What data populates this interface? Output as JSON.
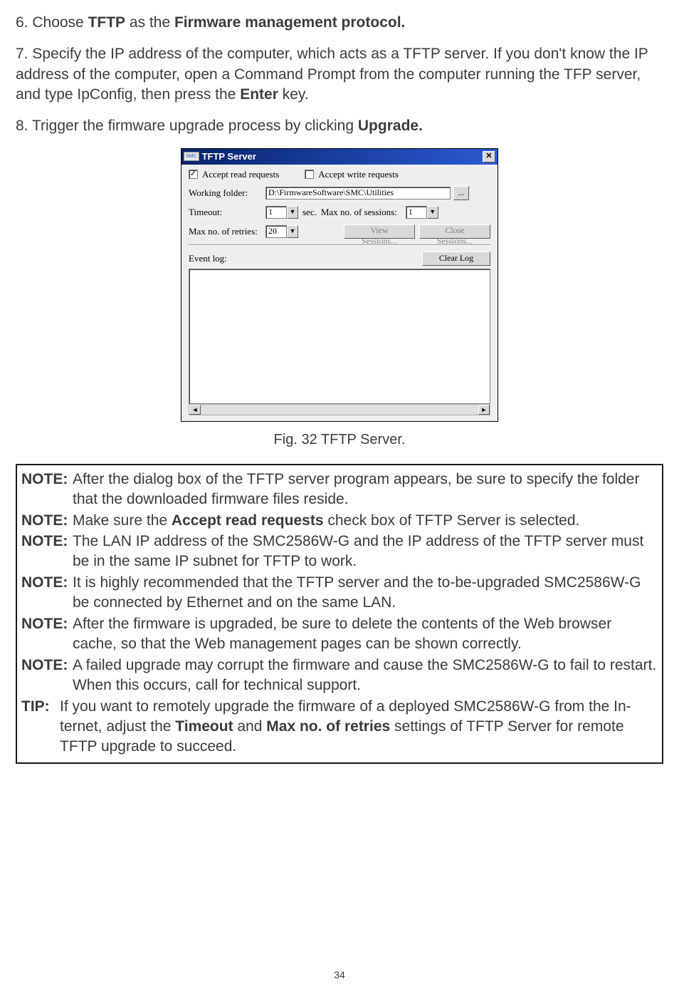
{
  "para6": {
    "prefix": "6. Choose ",
    "bold1": "TFTP",
    "middle": " as the ",
    "bold2": "Firmware management protocol."
  },
  "para7": {
    "text": "7. Specify the IP address of the computer, which acts as a TFTP server. If you don't know the IP address of the computer, open a Command Prompt from the computer running the TFP server, and type IpConfig, then press the ",
    "bold": "Enter",
    "tail": " key."
  },
  "para8": {
    "prefix": "8. Trigger the firmware upgrade process by clicking ",
    "bold": "Upgrade."
  },
  "dialog": {
    "badge": "SMC",
    "title": "TFTP Server",
    "close_glyph": "✕",
    "accept_read_label": "Accept read requests",
    "accept_read_checked": "✓",
    "accept_write_label": "Accept write requests",
    "working_folder_label": "Working folder:",
    "working_folder_value": "D:\\FirmwareSoftware\\SMC\\Utilities",
    "ellipsis_label": "...",
    "timeout_label": "Timeout:",
    "timeout_value": "1",
    "sec_label": "sec.",
    "max_sessions_label": "Max no. of sessions:",
    "max_sessions_value": "1",
    "max_retries_label": "Max no. of retries:",
    "max_retries_value": "20",
    "view_sessions_label": "View Sessions...",
    "close_sessions_label": "Close Sessions...",
    "event_log_label": "Event log:",
    "clear_log_label": "Clear Log",
    "arrow_down": "▼",
    "arrow_left": "◄",
    "arrow_right": "►"
  },
  "figcap": "Fig. 32 TFTP Server.",
  "notes": {
    "label_note": "NOTE:",
    "label_tip": "TIP:",
    "n1": "After the dialog box of the TFTP server program appears, be sure to specify the folder that the downloaded firmware files reside.",
    "n2_pre": "Make sure the ",
    "n2_bold": "Accept read requests",
    "n2_post": " check box of TFTP Server is selected.",
    "n3": "The LAN IP address of the SMC2586W-G and the IP address of the TFTP server must be in the same IP subnet for TFTP to work.",
    "n4": "It is highly recommended that the TFTP server and the to-be-upgraded SMC2586W-G be connected by Ethernet and on the same LAN.",
    "n5": "After the firmware is upgraded, be sure to delete the contents of the Web browser cache, so that the Web management pages can be shown correctly.",
    "n6": "A failed upgrade may corrupt the firmware and cause the SMC2586W-G to fail to restart. When this occurs, call for technical support.",
    "tip_pre": "If you want to remotely upgrade the firmware of a deployed SMC2586W-G from the In-ternet, adjust the ",
    "tip_b1": "Timeout",
    "tip_mid": " and ",
    "tip_b2": "Max no. of retries",
    "tip_post": " settings of TFTP Server for remote TFTP upgrade to succeed."
  },
  "page_num": "34"
}
